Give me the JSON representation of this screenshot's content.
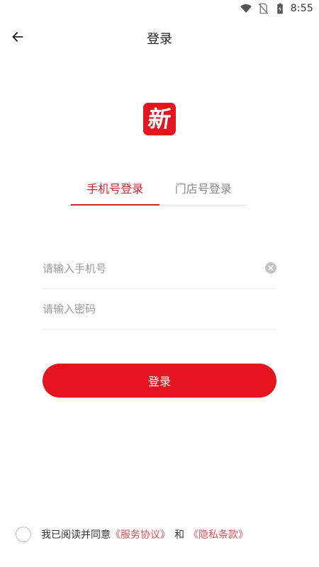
{
  "status_bar": {
    "time": "8:55",
    "icons": [
      "wifi-icon",
      "no-sim-icon",
      "battery-charging-icon"
    ]
  },
  "header": {
    "title": "登录",
    "back_icon": "arrow-left-icon"
  },
  "logo": {
    "char": "新",
    "color": "#e4151f"
  },
  "tabs": [
    {
      "label": "手机号登录",
      "active": true
    },
    {
      "label": "门店号登录",
      "active": false
    }
  ],
  "form": {
    "phone": {
      "value": "",
      "placeholder": "请输入手机号",
      "clear_icon": "clear-circle-icon"
    },
    "password": {
      "value": "",
      "placeholder": "请输入密码"
    },
    "submit_label": "登录"
  },
  "agreement": {
    "checked": false,
    "prefix": "我已阅读并同意",
    "terms_link": "《服务协议》",
    "and": "和",
    "privacy_link": "《隐私条款》"
  },
  "colors": {
    "accent": "#e4151f",
    "tab_active": "#d8232a",
    "link": "#e0505a"
  }
}
